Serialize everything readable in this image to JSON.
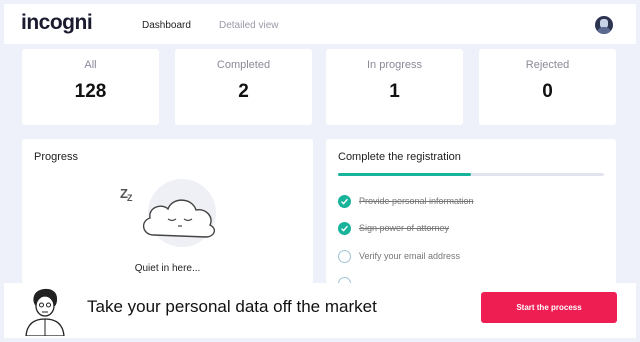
{
  "header": {
    "logo": "incogni",
    "nav": [
      {
        "label": "Dashboard",
        "active": true
      },
      {
        "label": "Detailed view",
        "active": false
      }
    ],
    "avatar_icon": "user-avatar-icon"
  },
  "stats": [
    {
      "label": "All",
      "value": "128"
    },
    {
      "label": "Completed",
      "value": "2"
    },
    {
      "label": "In progress",
      "value": "1"
    },
    {
      "label": "Rejected",
      "value": "0"
    }
  ],
  "progress": {
    "title": "Progress",
    "illustration_icon": "sleeping-cloud-icon",
    "sleep_letter": "Z",
    "empty_text": "Quiet in here..."
  },
  "registration": {
    "title": "Complete the registration",
    "progress_fraction": 0.5,
    "steps": [
      {
        "label": "Provide personal information",
        "done": true
      },
      {
        "label": "Sign power of attorney",
        "done": true
      },
      {
        "label": "Verify your email address",
        "done": false
      },
      {
        "label": "",
        "done": false
      }
    ]
  },
  "banner": {
    "text": "Take your personal data off the market",
    "cta_label": "Start the process",
    "illustration_icon": "person-illustration-icon"
  },
  "colors": {
    "accent_teal": "#17b39b",
    "cta_red": "#ee1d52",
    "background": "#eef0fa"
  }
}
